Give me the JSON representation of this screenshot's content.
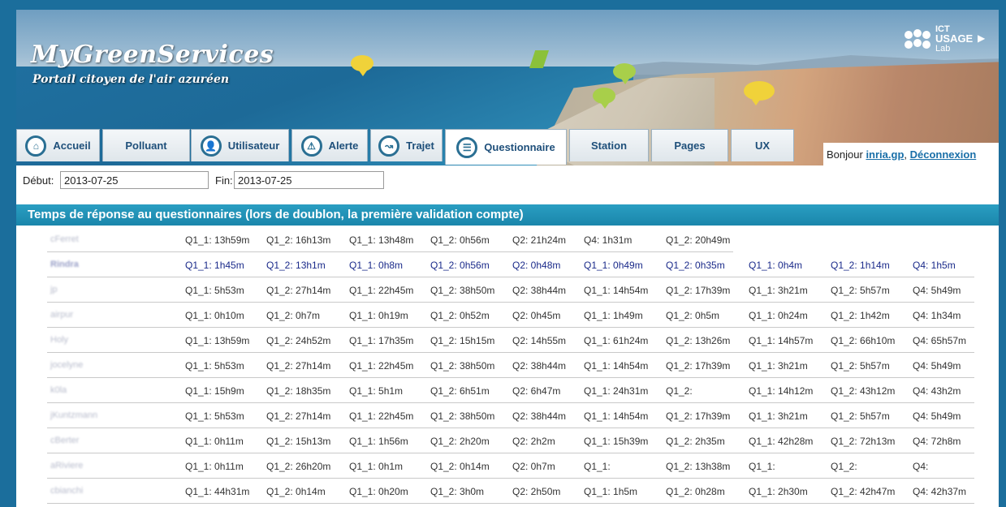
{
  "brand": {
    "title": "MyGreenServices",
    "subtitle": "Portail citoyen de l'air azuréen",
    "logo_text": {
      "l1": "ICT",
      "l2": "USAGE",
      "l3": "Lab"
    }
  },
  "tabs": [
    {
      "label": "Accueil",
      "icon": "home-icon"
    },
    {
      "label": "Polluant",
      "icon": ""
    },
    {
      "label": "Utilisateur",
      "icon": "user-icon"
    },
    {
      "label": "Alerte",
      "icon": "alert-icon"
    },
    {
      "label": "Trajet",
      "icon": "route-icon"
    },
    {
      "label": "Questionnaire",
      "icon": "questionnaire-icon",
      "active": true
    },
    {
      "label": "Station",
      "icon": ""
    },
    {
      "label": "Pages",
      "icon": ""
    },
    {
      "label": "UX",
      "icon": ""
    }
  ],
  "user": {
    "greeting": "Bonjour",
    "username": "inria.gp",
    "separator": ",",
    "logout": "Déconnexion"
  },
  "filters": {
    "start_label": "Début:",
    "start_value": "2013-07-25",
    "end_label": "Fin:",
    "end_value": "2013-07-25"
  },
  "section": {
    "title": "Temps de réponse au questionnaires (lors de doublon, la première validation compte)"
  },
  "rows": [
    {
      "name": "cFerret",
      "cells": [
        "Q1_1: 13h59m",
        "Q1_2: 16h13m",
        "Q1_1: 13h48m",
        "Q1_2: 0h56m",
        "Q2: 21h24m",
        "Q4: 1h31m",
        "Q1_2: 20h49m",
        "",
        "",
        ""
      ]
    },
    {
      "name": "Rindra",
      "bold": true,
      "cells": [
        "Q1_1: 1h45m",
        "Q1_2: 13h1m",
        "Q1_1: 0h8m",
        "Q1_2: 0h56m",
        "Q2: 0h48m",
        "Q1_1: 0h49m",
        "Q1_2: 0h35m",
        "Q1_1: 0h4m",
        "Q1_2: 1h14m",
        "Q4: 1h5m"
      ]
    },
    {
      "name": "jp",
      "cells": [
        "Q1_1: 5h53m",
        "Q1_2: 27h14m",
        "Q1_1: 22h45m",
        "Q1_2: 38h50m",
        "Q2: 38h44m",
        "Q1_1: 14h54m",
        "Q1_2: 17h39m",
        "Q1_1: 3h21m",
        "Q1_2: 5h57m",
        "Q4: 5h49m"
      ]
    },
    {
      "name": "airpur",
      "cells": [
        "Q1_1: 0h10m",
        "Q1_2: 0h7m",
        "Q1_1: 0h19m",
        "Q1_2: 0h52m",
        "Q2: 0h45m",
        "Q1_1: 1h49m",
        "Q1_2: 0h5m",
        "Q1_1: 0h24m",
        "Q1_2: 1h42m",
        "Q4: 1h34m"
      ]
    },
    {
      "name": "Holy",
      "cells": [
        "Q1_1: 13h59m",
        "Q1_2: 24h52m",
        "Q1_1: 17h35m",
        "Q1_2: 15h15m",
        "Q2: 14h55m",
        "Q1_1: 61h24m",
        "Q1_2: 13h26m",
        "Q1_1: 14h57m",
        "Q1_2: 66h10m",
        "Q4: 65h57m"
      ]
    },
    {
      "name": "jocelyne",
      "cells": [
        "Q1_1: 5h53m",
        "Q1_2: 27h14m",
        "Q1_1: 22h45m",
        "Q1_2: 38h50m",
        "Q2: 38h44m",
        "Q1_1: 14h54m",
        "Q1_2: 17h39m",
        "Q1_1: 3h21m",
        "Q1_2: 5h57m",
        "Q4: 5h49m"
      ]
    },
    {
      "name": "k0la",
      "cells": [
        "Q1_1: 15h9m",
        "Q1_2: 18h35m",
        "Q1_1: 5h1m",
        "Q1_2: 6h51m",
        "Q2: 6h47m",
        "Q1_1: 24h31m",
        "Q1_2:",
        "Q1_1: 14h12m",
        "Q1_2: 43h12m",
        "Q4: 43h2m"
      ]
    },
    {
      "name": "jKuntzmann",
      "cells": [
        "Q1_1: 5h53m",
        "Q1_2: 27h14m",
        "Q1_1: 22h45m",
        "Q1_2: 38h50m",
        "Q2: 38h44m",
        "Q1_1: 14h54m",
        "Q1_2: 17h39m",
        "Q1_1: 3h21m",
        "Q1_2: 5h57m",
        "Q4: 5h49m"
      ]
    },
    {
      "name": "cBerter",
      "cells": [
        "Q1_1: 0h11m",
        "Q1_2: 15h13m",
        "Q1_1: 1h56m",
        "Q1_2: 2h20m",
        "Q2: 2h2m",
        "Q1_1: 15h39m",
        "Q1_2: 2h35m",
        "Q1_1: 42h28m",
        "Q1_2: 72h13m",
        "Q4: 72h8m"
      ]
    },
    {
      "name": "aRiviere",
      "cells": [
        "Q1_1: 0h11m",
        "Q1_2: 26h20m",
        "Q1_1: 0h1m",
        "Q1_2: 0h14m",
        "Q2: 0h7m",
        "Q1_1:",
        "Q1_2: 13h38m",
        "Q1_1:",
        "Q1_2:",
        "Q4:"
      ]
    },
    {
      "name": "cbianchi",
      "cells": [
        "Q1_1: 44h31m",
        "Q1_2: 0h14m",
        "Q1_1: 0h20m",
        "Q1_2: 3h0m",
        "Q2: 2h50m",
        "Q1_1: 1h5m",
        "Q1_2: 0h28m",
        "Q1_1: 2h30m",
        "Q1_2: 42h47m",
        "Q4: 42h37m"
      ]
    }
  ]
}
